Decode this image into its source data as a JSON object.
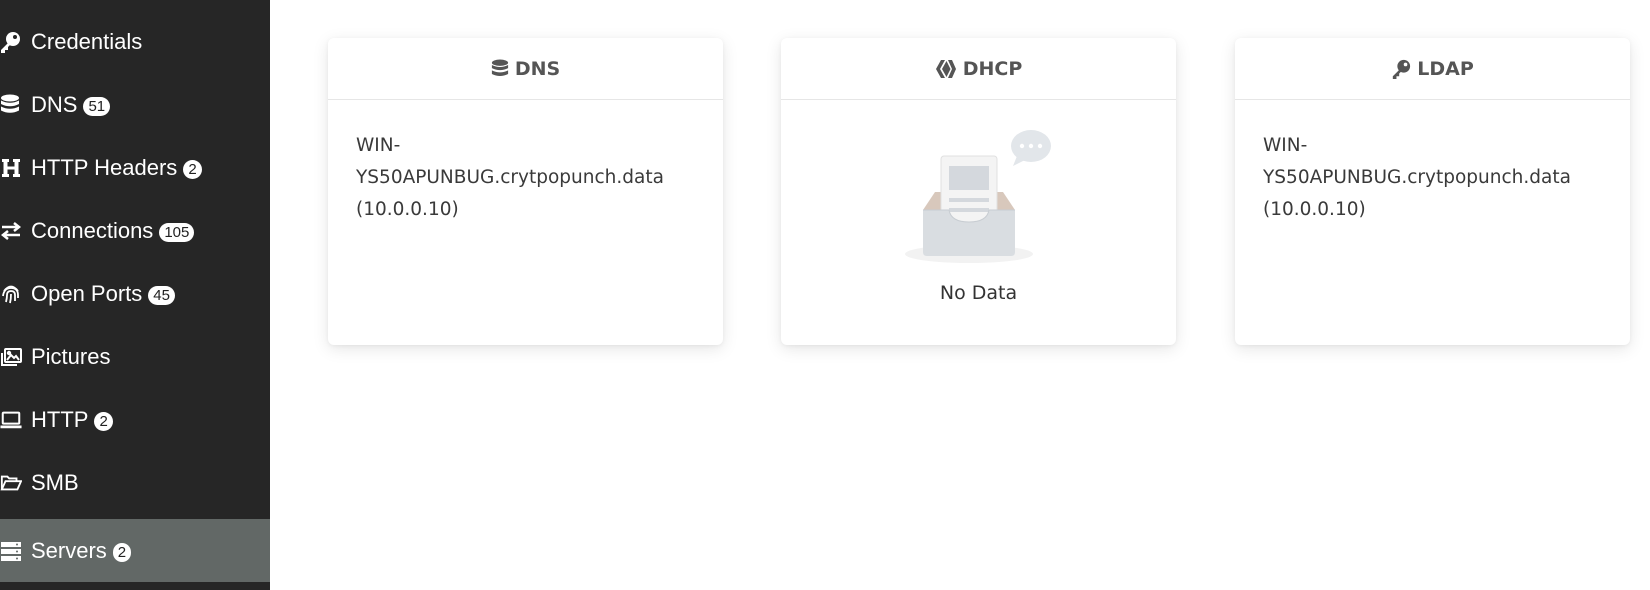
{
  "sidebar": {
    "items": [
      {
        "label": "Credentials",
        "icon": "key-icon",
        "badge": null
      },
      {
        "label": "DNS",
        "icon": "database-icon",
        "badge": "51"
      },
      {
        "label": "HTTP Headers",
        "icon": "heading-icon",
        "badge": "2"
      },
      {
        "label": "Connections",
        "icon": "exchange-icon",
        "badge": "105"
      },
      {
        "label": "Open Ports",
        "icon": "fingerprint-icon",
        "badge": "45"
      },
      {
        "label": "Pictures",
        "icon": "images-icon",
        "badge": null
      },
      {
        "label": "HTTP",
        "icon": "laptop-icon",
        "badge": "2"
      },
      {
        "label": "SMB",
        "icon": "folder-open-icon",
        "badge": null
      },
      {
        "label": "Servers",
        "icon": "server-icon",
        "badge": "2",
        "active": true
      }
    ]
  },
  "cards": {
    "dns": {
      "title": "DNS",
      "lines": [
        "WIN-",
        "YS50APUNBUG.crytpopunch.data",
        "(10.0.0.10)"
      ]
    },
    "dhcp": {
      "title": "DHCP",
      "empty_text": "No Data"
    },
    "ldap": {
      "title": "LDAP",
      "lines": [
        "WIN-",
        "YS50APUNBUG.crytpopunch.data",
        "(10.0.0.10)"
      ]
    }
  },
  "colors": {
    "sidebar_bg": "#262626",
    "sidebar_active_bg": "#626866",
    "header_text": "#555555"
  }
}
